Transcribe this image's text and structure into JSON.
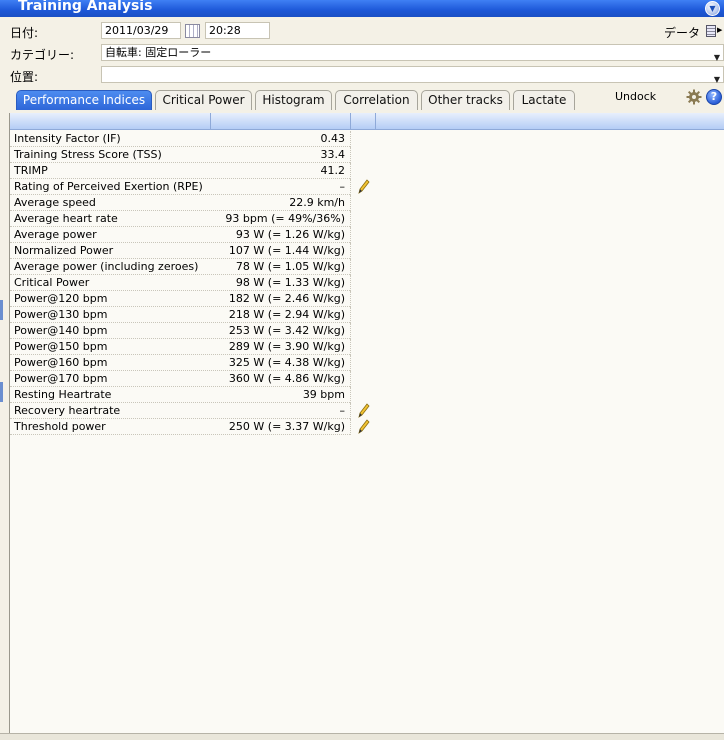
{
  "window": {
    "title": "Training Analysis"
  },
  "form": {
    "date_label": "日付:",
    "date_value": "2011/03/29",
    "time_value": "20:28",
    "data_label": "データ",
    "category_label": "カテゴリー:",
    "category_value": "自転車: 固定ローラー",
    "location_label": "位置:",
    "location_value": ""
  },
  "tabs": [
    {
      "label": "Performance Indices",
      "active": true
    },
    {
      "label": "Critical Power",
      "active": false
    },
    {
      "label": "Histogram",
      "active": false
    },
    {
      "label": "Correlation",
      "active": false
    },
    {
      "label": "Other tracks",
      "active": false
    },
    {
      "label": "Lactate",
      "active": false
    }
  ],
  "toolbar": {
    "undock_label": "Undock"
  },
  "table": {
    "rows": [
      {
        "label": "Intensity Factor (IF)",
        "value": "0.43",
        "editable": false
      },
      {
        "label": "Training Stress Score (TSS)",
        "value": "33.4",
        "editable": false
      },
      {
        "label": "TRIMP",
        "value": "41.2",
        "editable": false
      },
      {
        "label": "Rating of Perceived Exertion (RPE)",
        "value": "–",
        "editable": true
      },
      {
        "label": "Average speed",
        "value": "22.9 km/h",
        "editable": false
      },
      {
        "label": "Average heart rate",
        "value": "93 bpm (= 49%/36%)",
        "editable": false
      },
      {
        "label": "Average power",
        "value": "93 W (= 1.26 W/kg)",
        "editable": false
      },
      {
        "label": "Normalized Power",
        "value": "107 W (= 1.44 W/kg)",
        "editable": false
      },
      {
        "label": "Average power (including zeroes)",
        "value": "78 W (= 1.05 W/kg)",
        "editable": false
      },
      {
        "label": "Critical Power",
        "value": "98 W (= 1.33 W/kg)",
        "editable": false
      },
      {
        "label": "Power@120 bpm",
        "value": "182 W (= 2.46 W/kg)",
        "editable": false
      },
      {
        "label": "Power@130 bpm",
        "value": "218 W (= 2.94 W/kg)",
        "editable": false
      },
      {
        "label": "Power@140 bpm",
        "value": "253 W (= 3.42 W/kg)",
        "editable": false
      },
      {
        "label": "Power@150 bpm",
        "value": "289 W (= 3.90 W/kg)",
        "editable": false
      },
      {
        "label": "Power@160 bpm",
        "value": "325 W (= 4.38 W/kg)",
        "editable": false
      },
      {
        "label": "Power@170 bpm",
        "value": "360 W (= 4.86 W/kg)",
        "editable": false
      },
      {
        "label": "Resting Heartrate",
        "value": "39 bpm",
        "editable": false
      },
      {
        "label": "Recovery heartrate",
        "value": "–",
        "editable": true
      },
      {
        "label": "Threshold power",
        "value": "250 W (= 3.37 W/kg)",
        "editable": true
      }
    ]
  },
  "colors": {
    "accent": "#2e66d8",
    "title_bar": "#1d58d8",
    "background": "#f4f1e6"
  }
}
